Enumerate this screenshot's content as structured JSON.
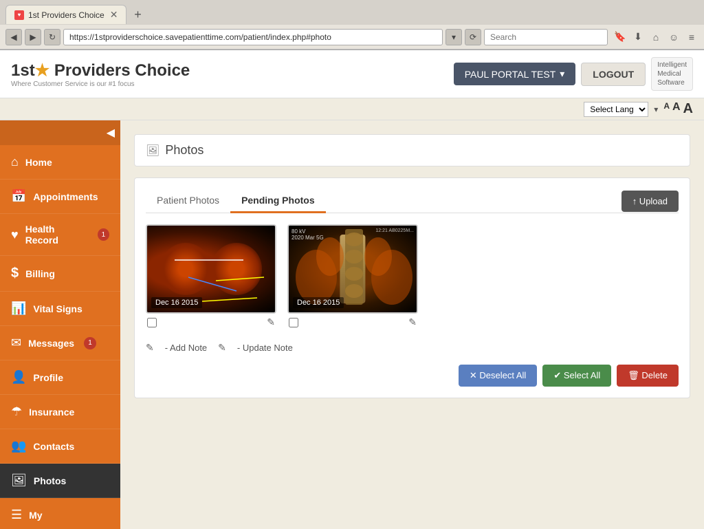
{
  "browser": {
    "tab_title": "1st Providers Choice",
    "tab_favicon": "♥",
    "url": "https://1stproviderschoice.savepatienttime.com/patient/index.php#photo",
    "search_placeholder": "Search"
  },
  "header": {
    "logo_text": "1st",
    "logo_star": "★",
    "logo_brand": "Providers Choice",
    "logo_sub": "Where Customer Service is our #1 focus",
    "portal_user": "PAUL PORTAL TEST",
    "logout_label": "LOGOUT",
    "ims_label": "Intelligent\nMedical\nSoftware"
  },
  "lang_bar": {
    "select_placeholder": "Select Lang",
    "font_small": "A",
    "font_medium": "A",
    "font_large": "A"
  },
  "sidebar": {
    "items": [
      {
        "id": "home",
        "icon": "⌂",
        "label": "Home",
        "badge": null,
        "active": false
      },
      {
        "id": "appointments",
        "icon": "📅",
        "label": "Appointments",
        "badge": null,
        "active": false
      },
      {
        "id": "health-record",
        "icon": "♥",
        "label": "Health Record",
        "badge": "1",
        "active": false
      },
      {
        "id": "billing",
        "icon": "$",
        "label": "Billing",
        "badge": null,
        "active": false
      },
      {
        "id": "vital-signs",
        "icon": "📊",
        "label": "Vital Signs",
        "badge": null,
        "active": false
      },
      {
        "id": "messages",
        "icon": "✉",
        "label": "Messages",
        "badge": "1",
        "active": false
      },
      {
        "id": "profile",
        "icon": "👤",
        "label": "Profile",
        "badge": null,
        "active": false
      },
      {
        "id": "insurance",
        "icon": "☂",
        "label": "Insurance",
        "badge": null,
        "active": false
      },
      {
        "id": "contacts",
        "icon": "👥",
        "label": "Contacts",
        "badge": null,
        "active": false
      },
      {
        "id": "photos",
        "icon": "🖼",
        "label": "Photos",
        "badge": null,
        "active": true
      },
      {
        "id": "my",
        "icon": "☰",
        "label": "My",
        "badge": null,
        "active": false
      }
    ]
  },
  "photos": {
    "page_icon": "🖼",
    "page_title": "Photos",
    "tab_patient": "Patient Photos",
    "tab_pending": "Pending Photos",
    "upload_label": "↑ Upload",
    "photos": [
      {
        "date": "Dec 16 2015",
        "type": "ct1"
      },
      {
        "date": "Dec 16 2015",
        "type": "ct2"
      }
    ],
    "add_note_icon": "✎",
    "add_note_label": "- Add Note",
    "update_note_icon": "✎",
    "update_note_label": "- Update Note",
    "deselect_label": "✕ Deselect All",
    "select_all_label": "✔ Select All",
    "delete_label": "🗑 Delete"
  }
}
